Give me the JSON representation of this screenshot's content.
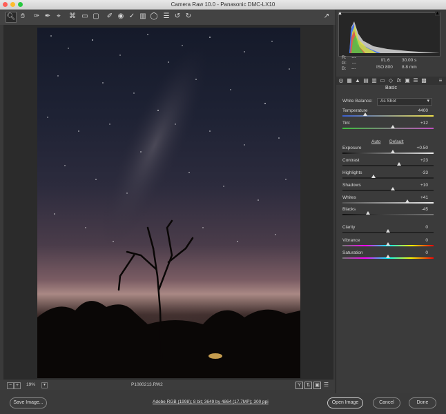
{
  "window": {
    "title": "Camera Raw 10.0  -  Panasonic DMC-LX10"
  },
  "toolbar": {
    "tools": [
      "zoom-tool",
      "hand-tool",
      "white-balance-tool",
      "color-sampler-tool",
      "target-adjustment-tool",
      "crop-tool",
      "straighten-tool",
      "transform-tool",
      "spot-removal-tool",
      "red-eye-tool",
      "adjustment-brush-tool",
      "graduated-filter-tool",
      "radial-filter-tool",
      "preferences-tool",
      "rotate-ccw-tool",
      "rotate-cw-tool"
    ]
  },
  "status": {
    "zoom": "19%",
    "filename": "P1080213.RW2"
  },
  "bottom": {
    "save_label": "Save Image...",
    "workflow_link": "Adobe RGB (1998); 8 bit; 3649 by 4864 (17.7MP); 300 ppi",
    "open_label": "Open Image",
    "cancel_label": "Cancel",
    "done_label": "Done"
  },
  "info": {
    "r_label": "R:",
    "r_val": "---",
    "g_label": "G:",
    "g_val": "---",
    "b_label": "B:",
    "b_val": "---",
    "aperture": "f/1.6",
    "shutter": "30.00 s",
    "iso": "ISO 800",
    "focal": "8.8 mm"
  },
  "panel": {
    "title": "Basic",
    "wb_label": "White Balance:",
    "wb_value": "As Shot",
    "auto": "Auto",
    "default": "Default",
    "sliders": [
      {
        "name": "temperature",
        "label": "Temperature",
        "value": "4400",
        "pos": 0.25
      },
      {
        "name": "tint",
        "label": "Tint",
        "value": "+12",
        "pos": 0.55
      },
      {
        "name": "exposure",
        "label": "Exposure",
        "value": "+0.50",
        "pos": 0.55
      },
      {
        "name": "contrast",
        "label": "Contrast",
        "value": "+23",
        "pos": 0.62
      },
      {
        "name": "highlights",
        "label": "Highlights",
        "value": "-33",
        "pos": 0.34
      },
      {
        "name": "shadows",
        "label": "Shadows",
        "value": "+10",
        "pos": 0.55
      },
      {
        "name": "whites",
        "label": "Whites",
        "value": "+41",
        "pos": 0.71
      },
      {
        "name": "blacks",
        "label": "Blacks",
        "value": "-45",
        "pos": 0.28
      },
      {
        "name": "clarity",
        "label": "Clarity",
        "value": "0",
        "pos": 0.5
      },
      {
        "name": "vibrance",
        "label": "Vibrance",
        "value": "0",
        "pos": 0.5
      },
      {
        "name": "saturation",
        "label": "Saturation",
        "value": "0",
        "pos": 0.5
      }
    ]
  }
}
